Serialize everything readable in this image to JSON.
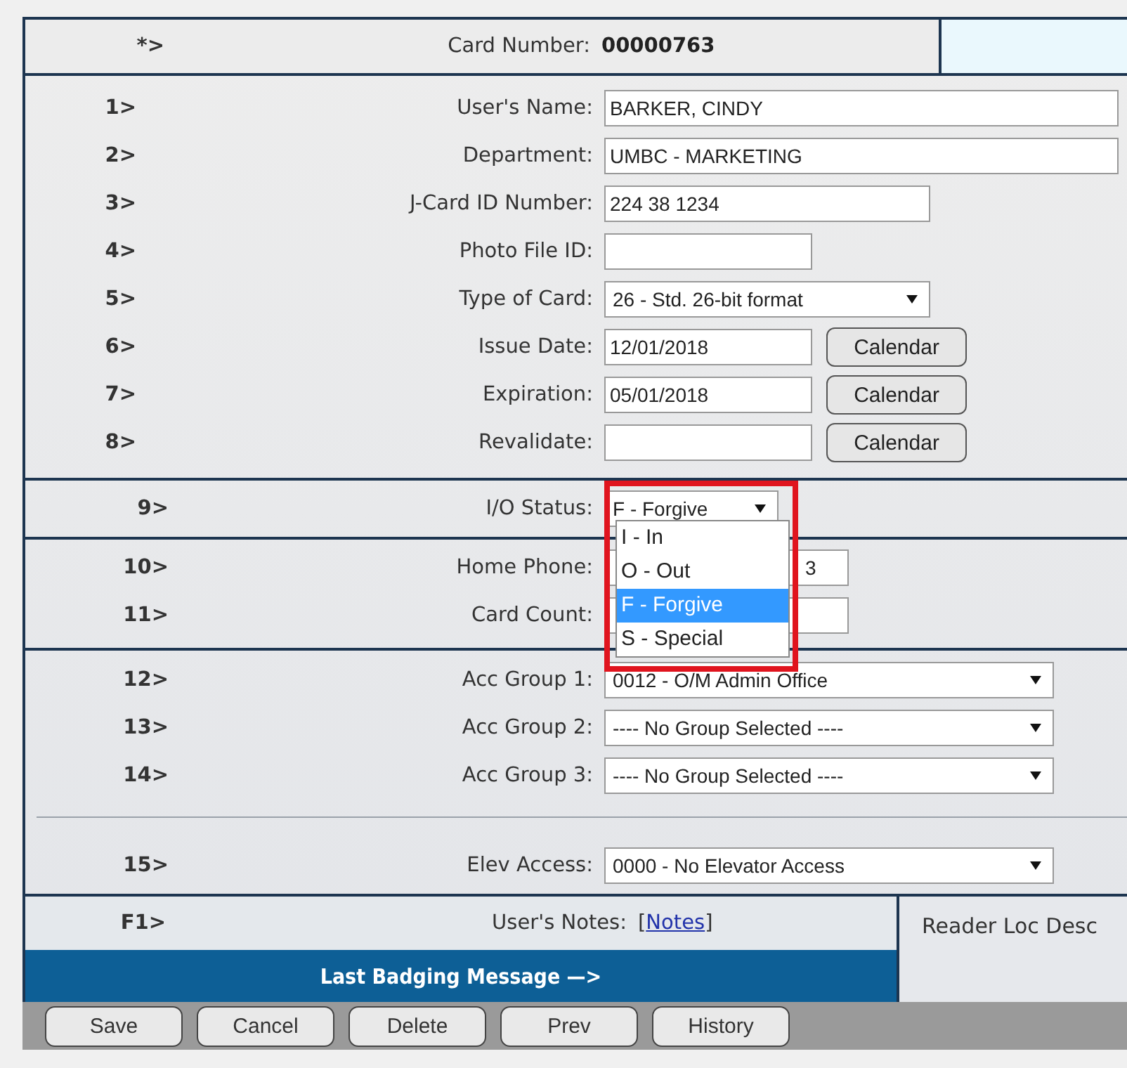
{
  "header": {
    "row_mark": "*>",
    "label": "Card Number:",
    "value": "00000763"
  },
  "sections": [
    {
      "fields": [
        {
          "number": "1>",
          "label": "User's Name:",
          "kind": "text",
          "value": "BARKER, CINDY"
        },
        {
          "number": "2>",
          "label": "Department:",
          "kind": "text",
          "value": "UMBC - MARKETING"
        },
        {
          "number": "3>",
          "label": "J-Card ID Number:",
          "kind": "text",
          "value": "224 38 1234"
        },
        {
          "number": "4>",
          "label": "Photo File ID:",
          "kind": "text"
        },
        {
          "number": "5>",
          "label": "Type of Card:",
          "kind": "select",
          "value": "26 - Std. 26-bit format"
        },
        {
          "number": "6>",
          "label": "Issue Date:",
          "kind": "date",
          "value": "12/01/2018",
          "button": "Calendar"
        },
        {
          "number": "7>",
          "label": "Expiration:",
          "kind": "date",
          "value": "05/01/2018",
          "button": "Calendar"
        },
        {
          "number": "8>",
          "label": "Revalidate:",
          "kind": "date",
          "button": "Calendar"
        }
      ]
    },
    {
      "fields": [
        {
          "number": "9>",
          "label": "I/O Status:",
          "kind": "select",
          "value": "F - Forgive",
          "open": true,
          "highlighted": true,
          "options": [
            {
              "label": "I - In",
              "selected": false
            },
            {
              "label": "O - Out",
              "selected": false
            },
            {
              "label": "F - Forgive",
              "selected": true
            },
            {
              "label": "S - Special",
              "selected": false
            }
          ]
        }
      ]
    },
    {
      "fields": [
        {
          "number": "10>",
          "label": "Home Phone:",
          "kind": "text",
          "value": "3"
        },
        {
          "number": "11>",
          "label": "Card Count:",
          "kind": "text"
        }
      ]
    },
    {
      "fields": [
        {
          "number": "12>",
          "label": "Acc Group 1:",
          "kind": "select",
          "value": "0012 - O/M Admin Office"
        },
        {
          "number": "13>",
          "label": "Acc Group 2:",
          "kind": "select",
          "value": "---- No Group Selected ----"
        },
        {
          "number": "14>",
          "label": "Acc Group 3:",
          "kind": "select",
          "value": "---- No Group Selected ----"
        }
      ]
    },
    {
      "fields": [
        {
          "number": "15>",
          "label": "Elev Access:",
          "kind": "select",
          "value": "0000 - No Elevator Access"
        }
      ]
    }
  ],
  "notes": {
    "number": "F1>",
    "label": "User's Notes:",
    "open_bracket": "[",
    "link": "Notes",
    "close_bracket": "]"
  },
  "reader_location": {
    "label": "Reader Loc Desc"
  },
  "badging_message": {
    "label": "Last Badging Message —>"
  },
  "buttons": [
    "Save",
    "Cancel",
    "Delete",
    "Prev",
    "History"
  ]
}
